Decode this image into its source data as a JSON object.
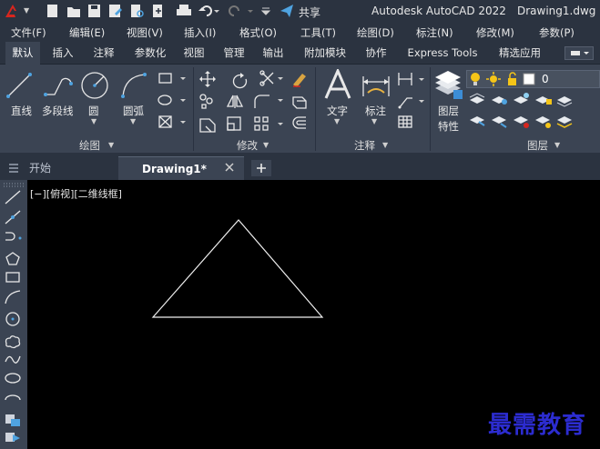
{
  "title": {
    "app_name": "Autodesk AutoCAD 2022",
    "file_name": "Drawing1.dwg",
    "share_label": "共享"
  },
  "menu": [
    "文件(F)",
    "编辑(E)",
    "视图(V)",
    "插入(I)",
    "格式(O)",
    "工具(T)",
    "绘图(D)",
    "标注(N)",
    "修改(M)",
    "参数(P)"
  ],
  "ribbon_tabs": [
    "默认",
    "插入",
    "注释",
    "参数化",
    "视图",
    "管理",
    "输出",
    "附加模块",
    "协作",
    "Express Tools",
    "精选应用"
  ],
  "active_ribbon_tab": "默认",
  "draw_panel": {
    "line_label": "直线",
    "polyline_label": "多段线",
    "circle_label": "圆",
    "arc_label": "圆弧",
    "panel_title": "绘图"
  },
  "modify_panel": {
    "panel_title": "修改"
  },
  "annotation_panel": {
    "text_label": "文字",
    "dimension_label": "标注",
    "panel_title": "注释"
  },
  "layers_panel": {
    "layer_props_label_1": "图层",
    "layer_props_label_2": "特性",
    "current_layer": "0",
    "panel_title": "图层"
  },
  "doc_tabs": [
    {
      "label": "开始",
      "active": false
    },
    {
      "label": "Drawing1*",
      "active": true
    }
  ],
  "viewport_label": "[−][俯视][二维线框]",
  "watermark": "最需教育",
  "colors": {
    "title_bg": "#2b3340",
    "ribbon_bg": "#3b4453",
    "canvas_bg": "#000000",
    "accent_red": "#d7261e",
    "accent_blue": "#4fa3e0",
    "watermark": "#2c2cd0"
  }
}
